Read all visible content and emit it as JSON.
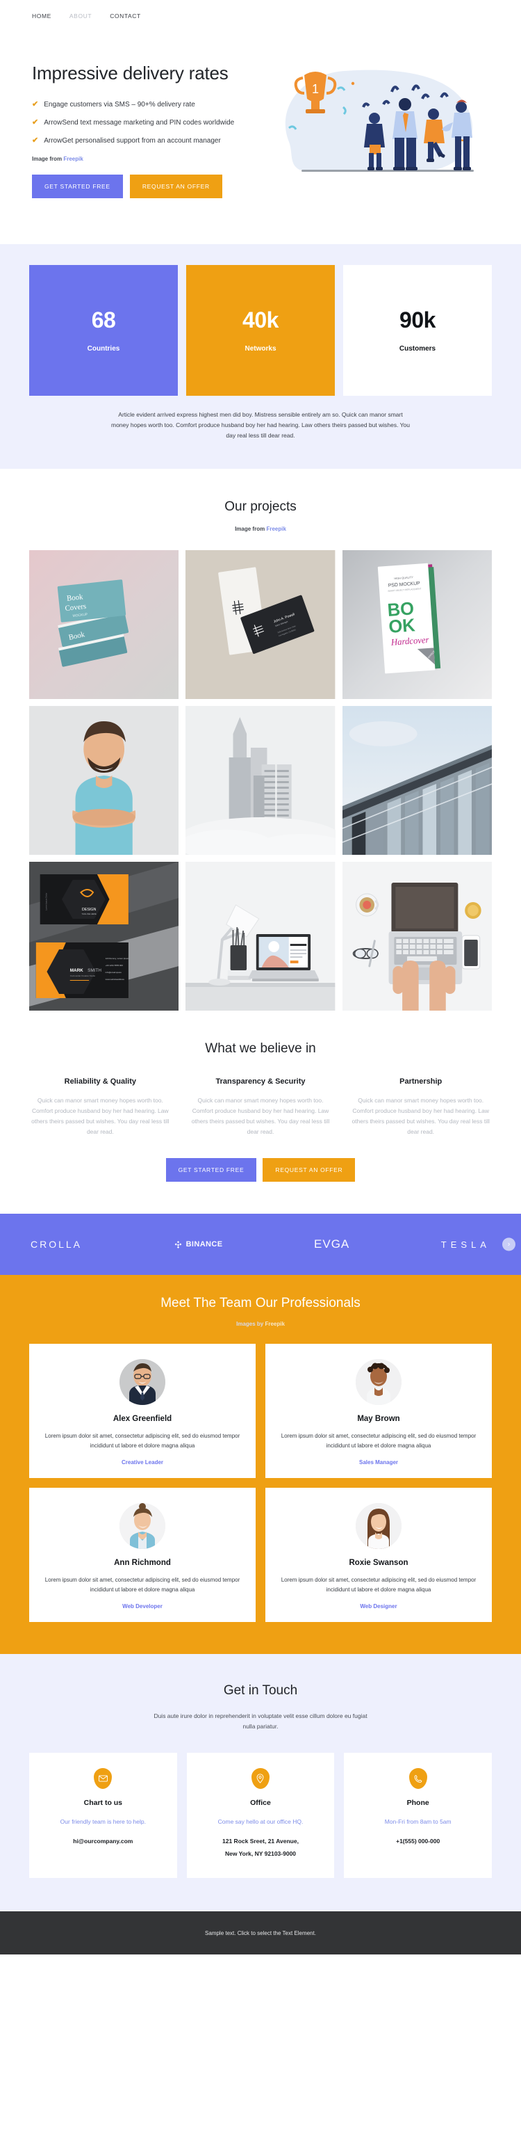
{
  "nav": {
    "items": [
      {
        "label": "HOME",
        "active": true
      },
      {
        "label": "ABOUT",
        "active": false
      },
      {
        "label": "CONTACT",
        "active": true
      }
    ]
  },
  "hero": {
    "title": "Impressive delivery rates",
    "bullets": [
      "Engage customers via SMS – 90+% delivery rate",
      "ArrowSend text message marketing and PIN codes worldwide",
      "ArrowGet personalised support from an account manager"
    ],
    "credit_prefix": "Image from",
    "credit_link": "Freepik",
    "primary_button": "GET STARTED FREE",
    "accent_button": "REQUEST AN OFFER",
    "illustration_name": "celebrating-team-with-trophy"
  },
  "stats": {
    "cards": [
      {
        "value": "68",
        "label": "Countries",
        "style": "purple",
        "color": "#6c74ed"
      },
      {
        "value": "40k",
        "label": "Networks",
        "style": "orange",
        "color": "#efa013"
      },
      {
        "value": "90k",
        "label": "Customers",
        "style": "white",
        "color": "#ffffff"
      }
    ],
    "note": "Article evident arrived express highest men did boy. Mistress sensible entirely am so. Quick can manor smart money hopes worth too. Comfort produce husband boy her had hearing. Law others theirs passed but wishes. You day real less till dear read."
  },
  "projects": {
    "title": "Our projects",
    "credit_prefix": "Image from",
    "credit_link": "Freepik",
    "tiles": [
      {
        "name": "book-covers-mockup",
        "caption": "Book Covers MOCKUP"
      },
      {
        "name": "business-cards-mockup",
        "caption": "John A. Powell"
      },
      {
        "name": "book-hardcover-mockup",
        "caption": "BOOK Hardcover"
      },
      {
        "name": "portrait-man-blue-shirt",
        "caption": ""
      },
      {
        "name": "foggy-skyscrapers",
        "caption": ""
      },
      {
        "name": "glass-office-facade",
        "caption": ""
      },
      {
        "name": "dark-orange-branding-cards",
        "caption": "MARK SMITH"
      },
      {
        "name": "desk-lamp-laptop-workspace",
        "caption": ""
      },
      {
        "name": "hands-typing-laptop-flatlay",
        "caption": ""
      }
    ]
  },
  "believe": {
    "title": "What we believe in",
    "columns": [
      {
        "heading": "Reliability & Quality",
        "body": "Quick can manor smart money hopes worth too. Comfort produce husband boy her had hearing. Law others theirs passed but wishes. You day real less till dear read."
      },
      {
        "heading": "Transparency & Security",
        "body": "Quick can manor smart money hopes worth too. Comfort produce husband boy her had hearing. Law others theirs passed but wishes. You day real less till dear read."
      },
      {
        "heading": "Partnership",
        "body": "Quick can manor smart money hopes worth too. Comfort produce husband boy her had hearing. Law others theirs passed but wishes. You day real less till dear read."
      }
    ],
    "primary_button": "GET STARTED FREE",
    "accent_button": "REQUEST AN OFFER"
  },
  "logos": {
    "background": "#6c74ed",
    "items": [
      {
        "name": "crolla-logo",
        "label": "CROLLA"
      },
      {
        "name": "binance-logo",
        "label": "BINANCE"
      },
      {
        "name": "evga-logo",
        "label": "EVGA"
      },
      {
        "name": "tesla-logo",
        "label": "TESLA"
      }
    ],
    "next_icon": "chevron-right-icon"
  },
  "team": {
    "title": "Meet The Team Our Professionals",
    "credit_prefix": "Images by",
    "credit_link": "Freepik",
    "members": [
      {
        "name": "Alex Greenfield",
        "bio": "Lorem ipsum dolor sit amet, consectetur adipiscing elit, sed do eiusmod tempor incididunt ut labore et dolore magna aliqua",
        "role": "Creative Leader",
        "avatar": "man-glasses-suit"
      },
      {
        "name": "May Brown",
        "bio": "Lorem ipsum dolor sit amet, consectetur adipiscing elit, sed do eiusmod tempor incididunt ut labore et dolore magna aliqua",
        "role": "Sales Manager",
        "avatar": "woman-curly-hair-smiling"
      },
      {
        "name": "Ann Richmond",
        "bio": "Lorem ipsum dolor sit amet, consectetur adipiscing elit, sed do eiusmod tempor incididunt ut labore et dolore magna aliqua",
        "role": "Web Developer",
        "avatar": "woman-bun-denim-shirt"
      },
      {
        "name": "Roxie Swanson",
        "bio": "Lorem ipsum dolor sit amet, consectetur adipiscing elit, sed do eiusmod tempor incididunt ut labore et dolore magna aliqua",
        "role": "Web Designer",
        "avatar": "woman-long-brown-hair"
      }
    ]
  },
  "contact": {
    "title": "Get in Touch",
    "lead": "Duis aute irure dolor in reprehenderit in voluptate velit esse cillum dolore eu fugiat nulla pariatur.",
    "cards": [
      {
        "icon": "envelope-icon",
        "heading": "Chart to us",
        "sub": "Our friendly team is here to help.",
        "value": "hi@ourcompany.com",
        "value2": ""
      },
      {
        "icon": "map-pin-icon",
        "heading": "Office",
        "sub": "Come say hello at our office HQ.",
        "value": "121 Rock Sreet, 21 Avenue,",
        "value2": "New York, NY 92103-9000"
      },
      {
        "icon": "phone-icon",
        "heading": "Phone",
        "sub": "Mon-Fri from 8am to 5am",
        "value": "+1(555) 000-000",
        "value2": ""
      }
    ]
  },
  "footer": {
    "text": "Sample text. Click to select the Text Element."
  },
  "theme": {
    "purple": "#6c74ed",
    "orange": "#efa013",
    "lavender_bg": "#eef0fd",
    "dark_footer": "#333436"
  }
}
